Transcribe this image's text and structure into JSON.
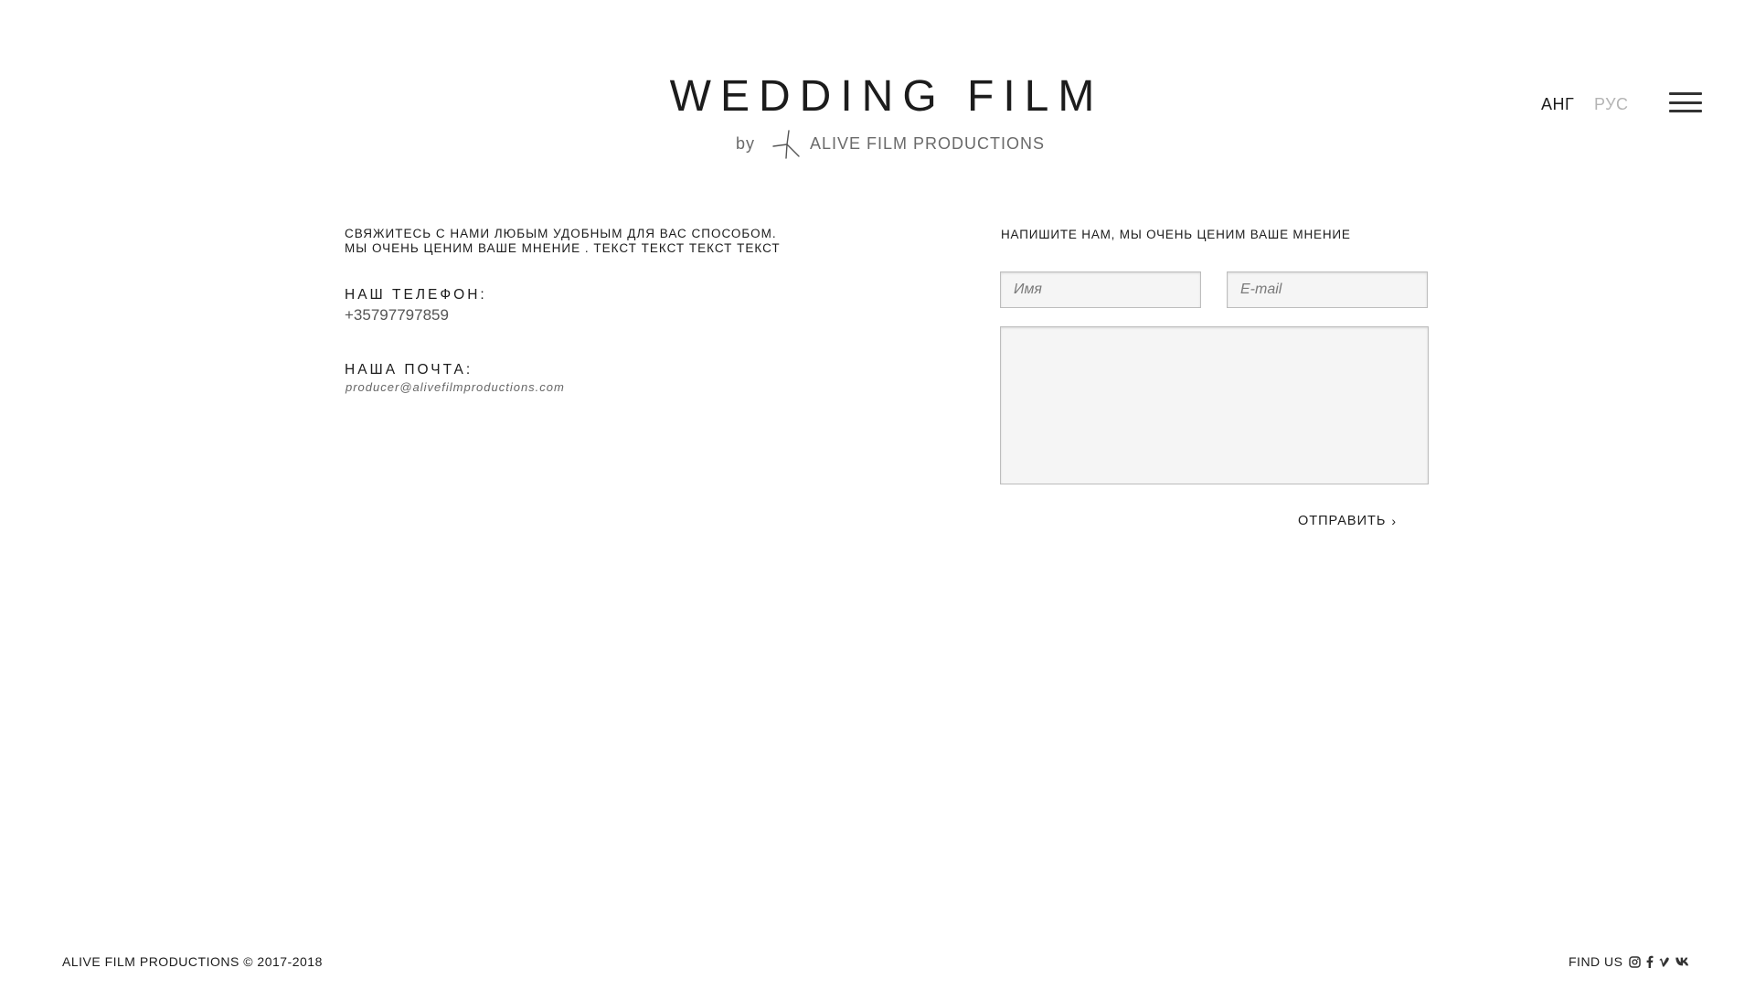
{
  "header": {
    "title": "WEDDING FILM",
    "by": "by",
    "company": "ALIVE FILM PRODUCTIONS",
    "lang_en": "АНГ",
    "lang_ru": "РУС"
  },
  "contact": {
    "intro_line1": "СВЯЖИТЕСЬ С НАМИ ЛЮБЫМ УДОБНЫМ ДЛЯ ВАС СПОСОБОМ.",
    "intro_line2": "МЫ ОЧЕНЬ ЦЕНИМ ВАШЕ МНЕНИЕ . ТЕКСТ ТЕКСТ ТЕКСТ ТЕКСТ",
    "phone_label": "НАШ ТЕЛЕФОН:",
    "phone": "+35797797859",
    "mail_label": "НАША ПОЧТА:",
    "email": "producer@alivefilmproductions.com"
  },
  "form": {
    "heading": "НАПИШИТЕ НАМ, МЫ ОЧЕНЬ ЦЕНИМ ВАШЕ МНЕНИЕ",
    "name_placeholder": "Имя",
    "email_placeholder": "E-mail",
    "message_value": "",
    "submit_label": "ОТПРАВИТЬ",
    "submit_chevron": "›"
  },
  "footer": {
    "copyright": "ALIVE FILM PRODUCTIONS © 2017-2018",
    "find_us": "FIND US",
    "social_icons": [
      "instagram-icon",
      "facebook-icon",
      "vimeo-icon",
      "vk-icon"
    ]
  },
  "colors": {
    "text": "#1c1c1c",
    "muted": "#b4b4b4",
    "field_bg": "#f5f5f5",
    "field_border": "#bdbdbd"
  }
}
